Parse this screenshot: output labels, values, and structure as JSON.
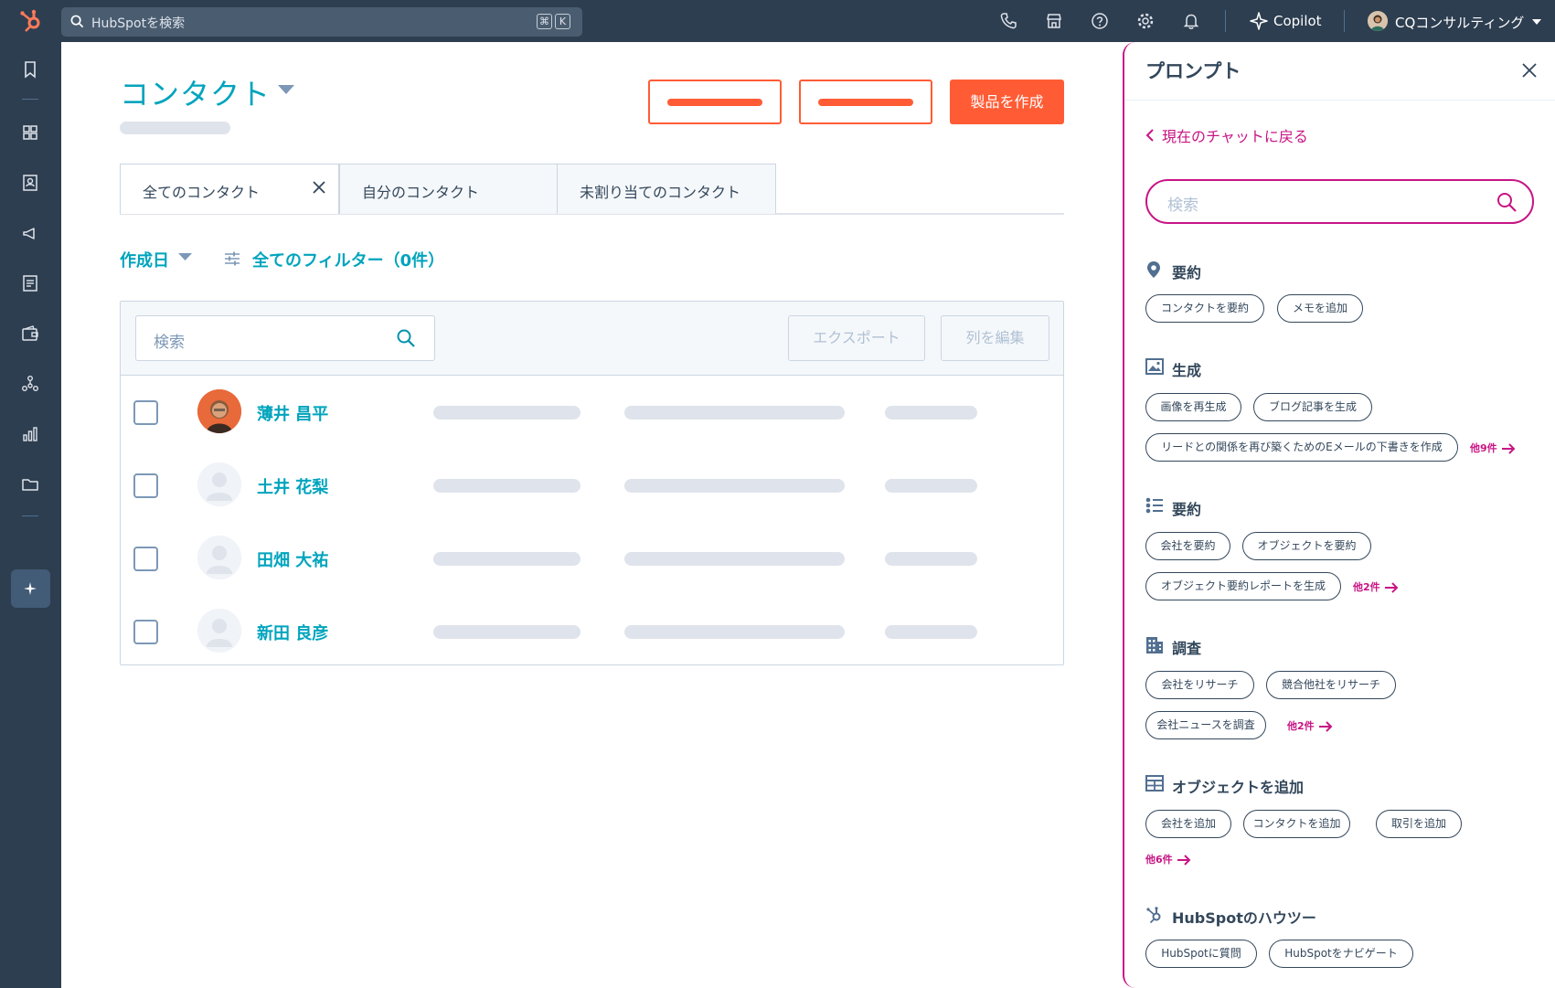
{
  "topbar": {
    "search_placeholder": "HubSpotを検索",
    "kbd_cmd": "⌘",
    "kbd_k": "K",
    "copilot_label": "Copilot",
    "account_name": "CQコンサルティング"
  },
  "main": {
    "title": "コンタクト",
    "create_button": "製品を作成",
    "tabs": [
      {
        "label": "全てのコンタクト"
      },
      {
        "label": "自分のコンタクト"
      },
      {
        "label": "未割り当てのコンタクト"
      }
    ],
    "filter_date": "作成日",
    "filter_all": "全てのフィルター（0件）",
    "table_search_placeholder": "検索",
    "export_button": "エクスポート",
    "edit_columns_button": "列を編集",
    "contacts": [
      {
        "name": "薄井 昌平",
        "has_photo": true
      },
      {
        "name": "土井 花梨",
        "has_photo": false
      },
      {
        "name": "田畑 大祐",
        "has_photo": false
      },
      {
        "name": "新田 良彦",
        "has_photo": false
      }
    ]
  },
  "panel": {
    "title": "プロンプト",
    "back_link": "現在のチャットに戻る",
    "search_placeholder": "検索",
    "sections": [
      {
        "icon": "map-pin-icon",
        "title": "要約",
        "chips": [
          "コンタクトを要約",
          "メモを追加"
        ],
        "more": ""
      },
      {
        "icon": "image-icon",
        "title": "生成",
        "chips": [
          "画像を再生成",
          "ブログ記事を生成",
          "リードとの関係を再び築くためのEメールの下書きを作成"
        ],
        "more": "他9件"
      },
      {
        "icon": "list-icon",
        "title": "要約",
        "chips": [
          "会社を要約",
          "オブジェクトを要約",
          "オブジェクト要約レポートを生成"
        ],
        "more": "他2件"
      },
      {
        "icon": "building-icon",
        "title": "調査",
        "chips": [
          "会社をリサーチ",
          "競合他社をリサーチ",
          "会社ニュースを調査"
        ],
        "more": "他2件"
      },
      {
        "icon": "table-icon",
        "title": "オブジェクトを追加",
        "chips": [
          "会社を追加",
          "コンタクトを追加",
          "取引を追加"
        ],
        "more": "他6件"
      },
      {
        "icon": "hubspot-icon",
        "title": "HubSpotのハウツー",
        "chips": [
          "HubSpotに質問",
          "HubSpotをナビゲート"
        ],
        "more": ""
      }
    ]
  },
  "colors": {
    "nav_bg": "#2d3e50",
    "accent_teal": "#00a4bd",
    "brand_orange": "#ff5c35",
    "copilot_magenta": "#c71585"
  }
}
